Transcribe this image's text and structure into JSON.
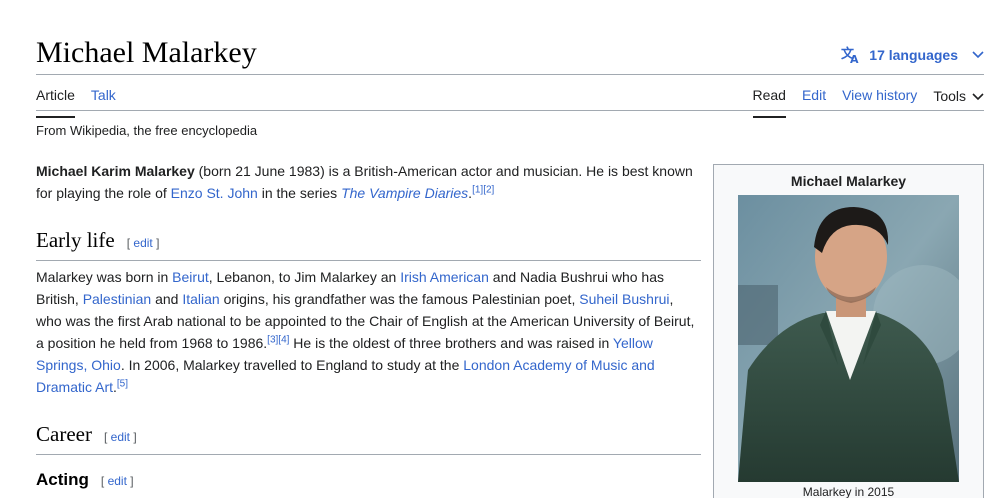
{
  "page": {
    "title": "Michael Malarkey",
    "languages_label": "17 languages",
    "tagline": "From Wikipedia, the free encyclopedia"
  },
  "tabs": {
    "article": "Article",
    "talk": "Talk",
    "read": "Read",
    "edit": "Edit",
    "view_history": "View history",
    "tools": "Tools"
  },
  "intro": {
    "name_bold": "Michael Karim Malarkey",
    "t1": " (born 21 June 1983) is a British-American actor and musician. He is best known for playing the role of ",
    "link_enzo": "Enzo St. John",
    "t2": " in the series ",
    "link_vd": "The Vampire Diaries",
    "t3": ".",
    "ref1": "[1]",
    "ref2": "[2]"
  },
  "early_life": {
    "heading": "Early life",
    "edit": "[ edit ]",
    "t1": "Malarkey was born in ",
    "link_beirut": "Beirut",
    "t2": ", Lebanon, to Jim Malarkey an ",
    "link_irish": "Irish American",
    "t3": " and Nadia Bushrui who has British, ",
    "link_palestinian": "Palestinian",
    "t4": " and ",
    "link_italian": "Italian",
    "t5": " origins, his grandfather was the famous Palestinian poet, ",
    "link_suheil": "Suheil Bushrui",
    "t6": ", who was the first Arab national to be appointed to the Chair of English at the American University of Beirut, a position he held from 1968 to 1986.",
    "ref3": "[3]",
    "ref4": "[4]",
    "t7": " He is the oldest of three brothers and was raised in ",
    "link_yellow": "Yellow Springs, Ohio",
    "t8": ". In 2006, Malarkey travelled to England to study at the ",
    "link_lamda": "London Academy of Music and Dramatic Art",
    "t9": ".",
    "ref5": "[5]"
  },
  "career": {
    "heading": "Career",
    "edit": "[ edit ]"
  },
  "acting": {
    "heading": "Acting",
    "edit": "[ edit ]"
  },
  "infobox": {
    "title": "Michael Malarkey",
    "caption": "Malarkey in 2015"
  },
  "colors": {
    "link": "#3366cc",
    "rule": "#a2a9b1",
    "infobox_bg": "#f8f9fa"
  },
  "icons": [
    "translate-icon",
    "chevron-down-icon"
  ]
}
